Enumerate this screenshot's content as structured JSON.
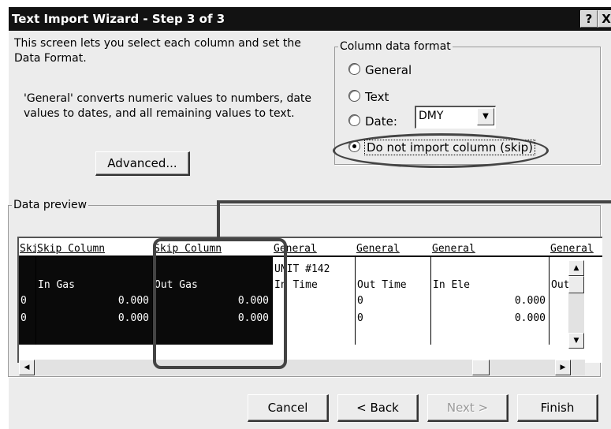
{
  "window": {
    "title": "Text Import Wizard - Step 3 of 3",
    "help_button": "?",
    "close_button": "X"
  },
  "intro": {
    "line1": "This screen lets you select each column and set the Data Format.",
    "line2": "'General' converts numeric values to numbers, date values to dates, and all remaining values to text."
  },
  "advanced_button": "Advanced...",
  "column_format": {
    "title": "Column data format",
    "options": [
      {
        "label": "General",
        "selected": false
      },
      {
        "label": "Text",
        "selected": false
      },
      {
        "label": "Date:",
        "selected": false
      },
      {
        "label": "Do not import column (skip)",
        "selected": true
      }
    ],
    "date_format": "DMY"
  },
  "preview": {
    "title": "Data preview",
    "columns": [
      {
        "header": "Skip",
        "skipped": true,
        "rows": [
          "",
          "",
          "",
          "0",
          "0"
        ]
      },
      {
        "header": "Skip Column",
        "skipped": true,
        "rows": [
          "",
          "",
          "In Gas",
          "0.000",
          "0.000"
        ]
      },
      {
        "header": "Skip Column",
        "skipped": true,
        "rows": [
          "",
          "",
          "Out Gas",
          "0.000",
          "0.000"
        ]
      },
      {
        "header": "General",
        "skipped": false,
        "rows": [
          "",
          "UNIT #142",
          "In Time",
          "",
          ""
        ]
      },
      {
        "header": "General",
        "skipped": false,
        "rows": [
          "",
          "",
          "Out Time",
          "0",
          "0"
        ]
      },
      {
        "header": "General",
        "skipped": false,
        "rows": [
          "",
          "",
          "In Ele",
          "0.000",
          "0.000"
        ]
      },
      {
        "header": "General",
        "skipped": false,
        "rows": [
          "",
          "",
          "Out",
          "",
          ""
        ]
      }
    ]
  },
  "buttons": {
    "cancel": "Cancel",
    "back": "< Back",
    "next": "Next >",
    "finish": "Finish"
  },
  "colors": {
    "titlebar": "#121212",
    "dialog_bg": "#ececec",
    "skipped_column_bg": "#0a0a0a",
    "annotation": "#444444"
  }
}
